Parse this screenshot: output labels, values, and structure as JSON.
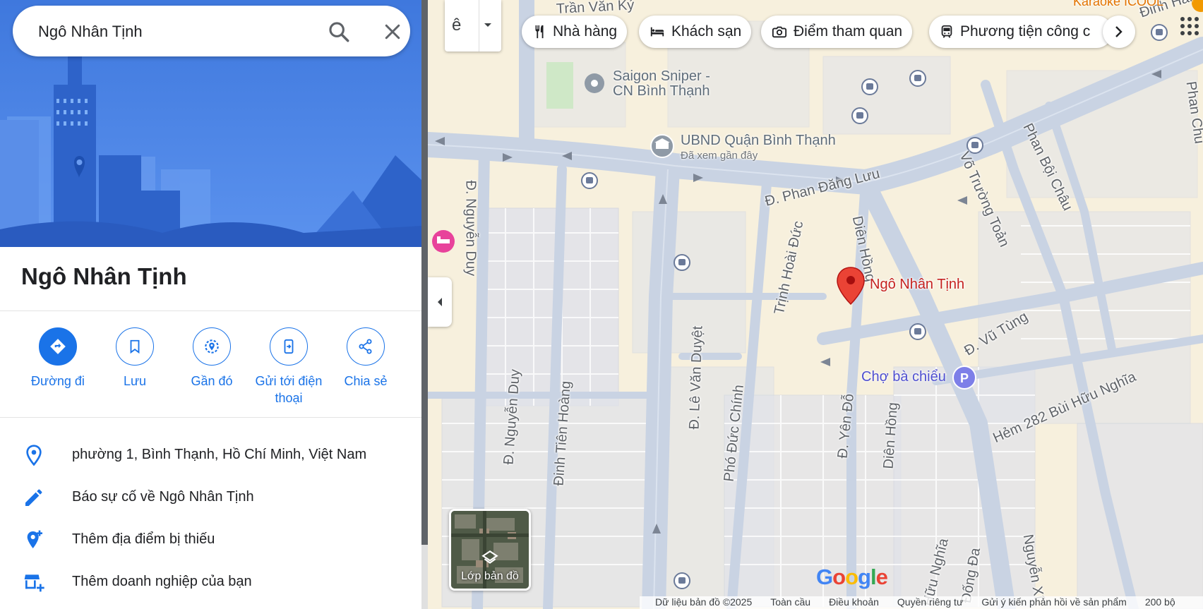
{
  "search": {
    "query": "Ngô Nhân Tịnh"
  },
  "place": {
    "title": "Ngô Nhân Tịnh"
  },
  "actions": [
    {
      "label": "Đường đi"
    },
    {
      "label": "Lưu"
    },
    {
      "label": "Gần đó"
    },
    {
      "label": "Gửi tới điện thoại"
    },
    {
      "label": "Chia sẻ"
    }
  ],
  "info": {
    "address": "phường 1, Bình Thạnh, Hồ Chí Minh, Việt Nam",
    "report": "Báo sự cố về Ngô Nhân Tịnh",
    "add_place": "Thêm địa điểm bị thiếu",
    "add_business": "Thêm doanh nghiệp của bạn"
  },
  "map": {
    "lang_char": "ê",
    "chips": [
      "Nhà hàng",
      "Khách sạn",
      "Điểm tham quan",
      "Phương tiện công c"
    ],
    "layer_label": "Lớp bản đồ",
    "logo": "Google",
    "pin_label": "Ngô Nhân Tịnh",
    "pois": {
      "saigon_sniper": "Saigon Sniper - CN Bình Thạnh",
      "ubnd": "UBND Quận Bình Thạnh",
      "ubnd_sub": "Đã xem gần đây",
      "cho_ba_chieu": "Chợ bà chiểu",
      "karaoke": "Karaoke ICOOL"
    },
    "roads": {
      "tran_van_ky": "Trần Văn Kỷ",
      "phan_dang_luu": "Đ. Phan Đăng Lưu",
      "nguyen_duy_top": "Đ. Nguyễn Duy",
      "dien_hong_top": "Diên Hồng",
      "trinh_hoai_duc": "Trịnh Hoài Đức",
      "vo_truong_toan": "Võ Trường Toản",
      "phan_boi_chau": "Phan Bội Châu",
      "vu_tung": "Đ. Vũ Tùng",
      "le_van_duyet": "Đ. Lê Văn Duyệt",
      "dinh_tien_hoang": "Đinh Tiên Hoàng",
      "nguyen_duy_bot": "Đ. Nguyễn Duy",
      "pho_duc_chinh": "Phó Đức Chính",
      "yen_do": "Đ. Yên Đỗ",
      "dien_hong_bot": "Diên Hồng",
      "hem_282": "Hẻm 282 Bùi Hữu Nghĩa",
      "huu_nghia": "Hữu Nghĩa",
      "dong_da": "Đống Đa",
      "nguyen_xi": "Nguyễn Xí",
      "phan_chu": "Phan Chu",
      "dinh_hai": "Đinh Hai"
    },
    "footer": [
      "Dữ liệu bản đồ ©2025",
      "Toàn cầu",
      "Điều khoản",
      "Quyền riêng tư",
      "Gửi ý kiến phản hồi về sản phẩm",
      "200 bộ"
    ]
  },
  "colors": {
    "accent": "#1a73e8",
    "hero_bg": "#4f86e6",
    "pin": "#ea4335"
  }
}
